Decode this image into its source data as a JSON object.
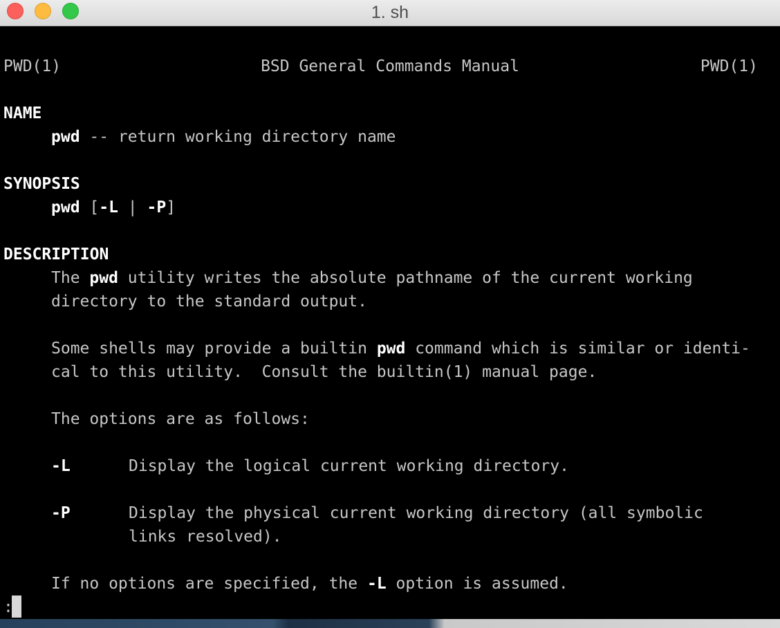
{
  "window": {
    "title": "1. sh"
  },
  "man": {
    "header": {
      "left": "PWD(1)",
      "center": "BSD General Commands Manual",
      "right": "PWD(1)"
    },
    "name": {
      "heading": "NAME",
      "cmd": "pwd",
      "text": " -- return working directory name"
    },
    "synopsis": {
      "heading": "SYNOPSIS",
      "cmd": "pwd",
      "open": " [",
      "opt_l": "-L",
      "pipe": " | ",
      "opt_p": "-P",
      "close": "]"
    },
    "description": {
      "heading": "DESCRIPTION",
      "p1_l1_a": "The ",
      "p1_l1_b": "pwd",
      "p1_l1_c": " utility writes the absolute pathname of the current working",
      "p1_l2": "directory to the standard output.",
      "p2_l1_a": "Some shells may provide a builtin ",
      "p2_l1_b": "pwd",
      "p2_l1_c": " command which is similar or identi-",
      "p2_l2": "cal to this utility.  Consult the builtin(1) manual page.",
      "p3": "The options are as follows:",
      "opt_l_flag": "-L",
      "opt_l_desc": "Display the logical current working directory.",
      "opt_p_flag": "-P",
      "opt_p_desc_l1": "Display the physical current working directory (all symbolic",
      "opt_p_desc_l2": "links resolved).",
      "p4_a": "If no options are specified, the ",
      "p4_b": "-L",
      "p4_c": " option is assumed."
    }
  },
  "pager": {
    "prompt": ":"
  }
}
